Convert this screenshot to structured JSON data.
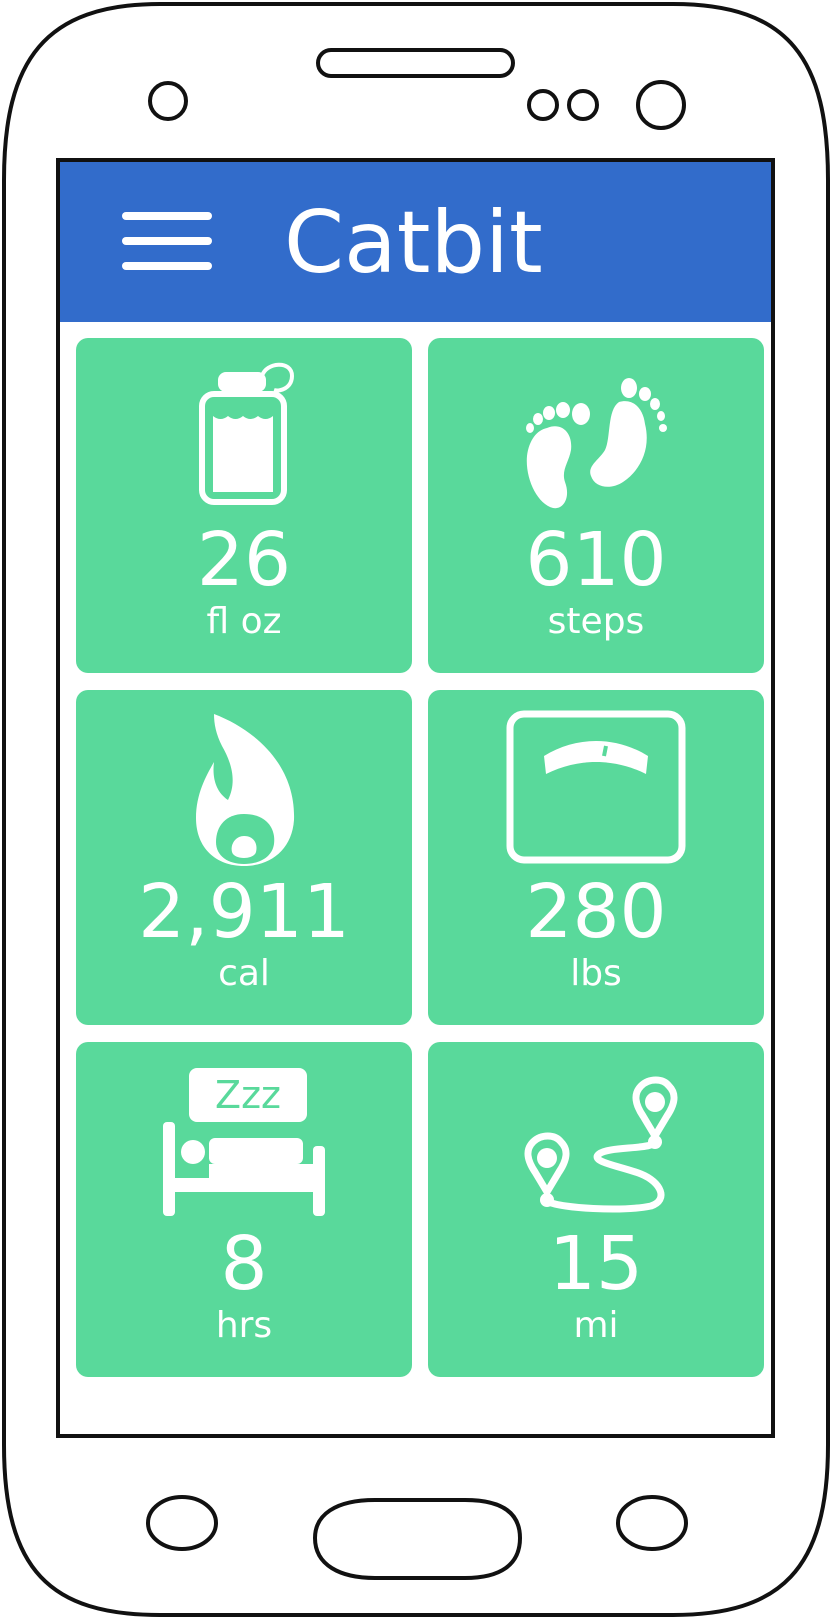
{
  "app": {
    "title": "Catbit"
  },
  "stats": [
    {
      "name": "water",
      "value": "26",
      "unit": "fl oz",
      "icon": "water-bottle-icon"
    },
    {
      "name": "steps",
      "value": "610",
      "unit": "steps",
      "icon": "footprints-icon"
    },
    {
      "name": "calories",
      "value": "2,911",
      "unit": "cal",
      "icon": "flame-icon"
    },
    {
      "name": "weight",
      "value": "280",
      "unit": "lbs",
      "icon": "scale-icon"
    },
    {
      "name": "sleep",
      "value": "8",
      "unit": "hrs",
      "icon": "bed-zzz-icon"
    },
    {
      "name": "distance",
      "value": "15",
      "unit": "mi",
      "icon": "route-pins-icon"
    }
  ],
  "sleep_icon_text": "Zzz",
  "colors": {
    "app_bar": "#326ccb",
    "tile": "#59d99b",
    "tile_text": "#ffffff"
  }
}
